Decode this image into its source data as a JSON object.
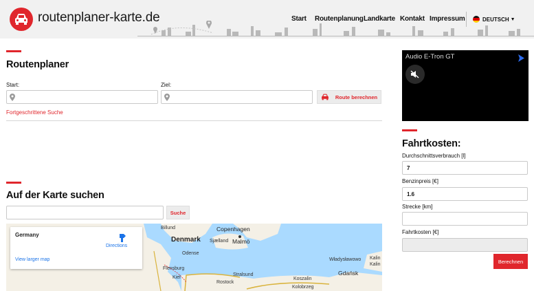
{
  "header": {
    "site_name": "routenplaner-karte.de",
    "nav": [
      {
        "label": "Start"
      },
      {
        "label": "Routenplanung"
      },
      {
        "label": "Landkarte"
      },
      {
        "label": "Kontakt"
      },
      {
        "label": "Impressum"
      }
    ],
    "language": "DEUTSCH",
    "language_arrow": "▼"
  },
  "routenplaner": {
    "title": "Routenplaner",
    "start_label": "Start:",
    "ziel_label": "Ziel:",
    "start_value": "",
    "ziel_value": "",
    "button_label": "Route berechnen",
    "advanced_link": "Fortgeschrittene Suche"
  },
  "karte": {
    "title": "Auf der Karte suchen",
    "search_value": "",
    "search_button": "Suche",
    "map": {
      "card_title": "Germany",
      "directions": "Directions",
      "larger_map": "View larger map",
      "places": [
        "Billund",
        "Copenhagen",
        "Denmark",
        "Sjælland",
        "Malmö",
        "Odense",
        "Flensburg",
        "Kiel",
        "Rostock",
        "Stralsund",
        "Koszalin",
        "Kolobrzeg",
        "Gdańsk",
        "Władysławowo"
      ],
      "places_partial": [
        "Kalin",
        "Kalin"
      ]
    }
  },
  "video": {
    "title": "Audio E-Tron GT"
  },
  "fahrtkosten": {
    "title": "Fahrtkosten:",
    "verbrauch_label": "Durchschnittsverbrauch [l]",
    "verbrauch_value": "7",
    "preis_label": "Benzinpreis [€]",
    "preis_value": "1.6",
    "strecke_label": "Strecke [km]",
    "strecke_value": "",
    "kosten_label": "Fahrtkosten [€]",
    "kosten_value": "",
    "button_label": "Berechnen"
  },
  "colors": {
    "accent": "#e0262c",
    "header_bg": "#f1f1f1",
    "water": "#aadaff",
    "land": "#f4f0e6"
  },
  "icons": [
    "car-icon",
    "map-pin-icon",
    "mute-icon",
    "directions-icon",
    "flag-de-icon"
  ]
}
